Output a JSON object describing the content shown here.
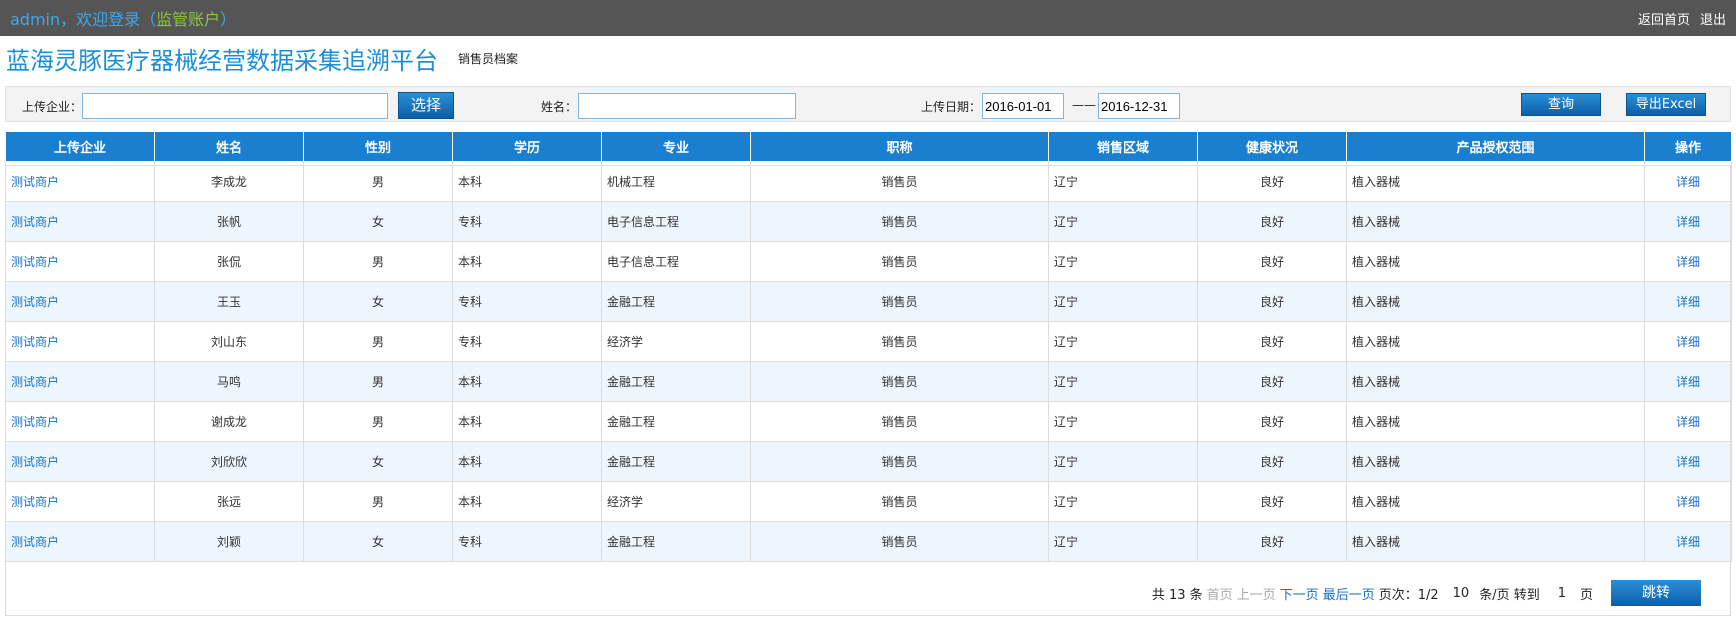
{
  "topbar": {
    "user": "admin",
    "welcome": "，欢迎登录（",
    "role": "监管账户",
    "close_paren": "）",
    "home": "返回首页",
    "logout": "退出"
  },
  "header": {
    "title": "蓝海灵豚医疗器械经营数据采集追溯平台",
    "subtitle": "销售员档案"
  },
  "search": {
    "company_label": "上传企业：",
    "company_value": "",
    "select_btn": "选择",
    "name_label": "姓名：",
    "name_value": "",
    "date_label": "上传日期：",
    "date_from": "2016-01-01",
    "dash": "——",
    "date_to": "2016-12-31",
    "query_btn": "查询",
    "export_btn": "导出Excel"
  },
  "table": {
    "headers": [
      "上传企业",
      "姓名",
      "性别",
      "学历",
      "专业",
      "职称",
      "销售区域",
      "健康状况",
      "产品授权范围",
      "操作"
    ],
    "rows": [
      [
        "测试商户",
        "李成龙",
        "男",
        "本科",
        "机械工程",
        "销售员",
        "辽宁",
        "良好",
        "植入器械",
        "详细"
      ],
      [
        "测试商户",
        "张帆",
        "女",
        "专科",
        "电子信息工程",
        "销售员",
        "辽宁",
        "良好",
        "植入器械",
        "详细"
      ],
      [
        "测试商户",
        "张侃",
        "男",
        "本科",
        "电子信息工程",
        "销售员",
        "辽宁",
        "良好",
        "植入器械",
        "详细"
      ],
      [
        "测试商户",
        "王玉",
        "女",
        "专科",
        "金融工程",
        "销售员",
        "辽宁",
        "良好",
        "植入器械",
        "详细"
      ],
      [
        "测试商户",
        "刘山东",
        "男",
        "专科",
        "经济学",
        "销售员",
        "辽宁",
        "良好",
        "植入器械",
        "详细"
      ],
      [
        "测试商户",
        "马鸣",
        "男",
        "本科",
        "金融工程",
        "销售员",
        "辽宁",
        "良好",
        "植入器械",
        "详细"
      ],
      [
        "测试商户",
        "谢成龙",
        "男",
        "本科",
        "金融工程",
        "销售员",
        "辽宁",
        "良好",
        "植入器械",
        "详细"
      ],
      [
        "测试商户",
        "刘欣欣",
        "女",
        "本科",
        "金融工程",
        "销售员",
        "辽宁",
        "良好",
        "植入器械",
        "详细"
      ],
      [
        "测试商户",
        "张远",
        "男",
        "本科",
        "经济学",
        "销售员",
        "辽宁",
        "良好",
        "植入器械",
        "详细"
      ],
      [
        "测试商户",
        "刘颖",
        "女",
        "专科",
        "金融工程",
        "销售员",
        "辽宁",
        "良好",
        "植入器械",
        "详细"
      ]
    ]
  },
  "pager": {
    "total": "共 13 条",
    "first": "首页",
    "prev": "上一页",
    "next": "下一页",
    "last": "最后一页",
    "page_info": "页次：1/2",
    "per_page": "10",
    "per_unit": "条/页 转到",
    "goto_value": "1",
    "page_unit": "页",
    "jump_btn": "跳转"
  }
}
